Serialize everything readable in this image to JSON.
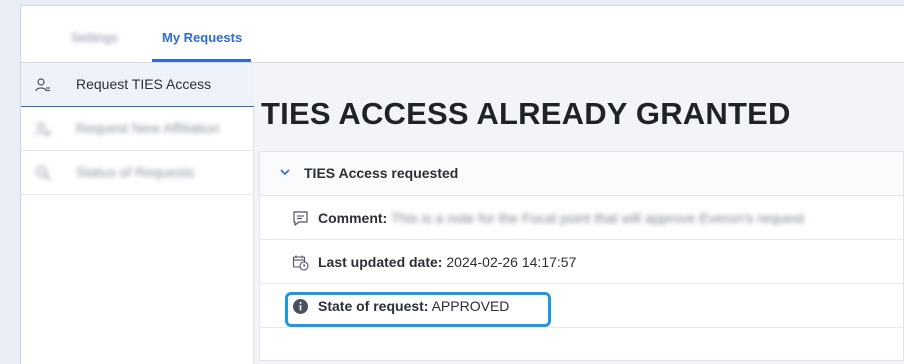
{
  "tabs": {
    "settings_label": "Settings",
    "my_requests_label": "My Requests"
  },
  "sidebar": {
    "items": [
      {
        "label": "Request TIES Access",
        "icon": "user-list-icon",
        "active": true
      },
      {
        "label": "Request New Affiliation",
        "icon": "user-add-icon",
        "active": false
      },
      {
        "label": "Status of Requests",
        "icon": "search-icon",
        "active": false
      }
    ]
  },
  "main": {
    "heading": "TIES ACCESS ALREADY GRANTED",
    "card": {
      "title": "TIES Access requested",
      "rows": {
        "comment": {
          "label": "Comment:",
          "value": "This is a note for the Focal point that will approve Everon's request",
          "icon": "comment-icon"
        },
        "last_updated": {
          "label": "Last updated date:",
          "value": "2024-02-26 14:17:57",
          "icon": "calendar-clock-icon"
        },
        "state": {
          "label": "State of request:",
          "value": "APPROVED",
          "icon": "info-icon"
        }
      }
    }
  },
  "colors": {
    "accent": "#2f6bd8",
    "highlight": "#1e9be0"
  }
}
